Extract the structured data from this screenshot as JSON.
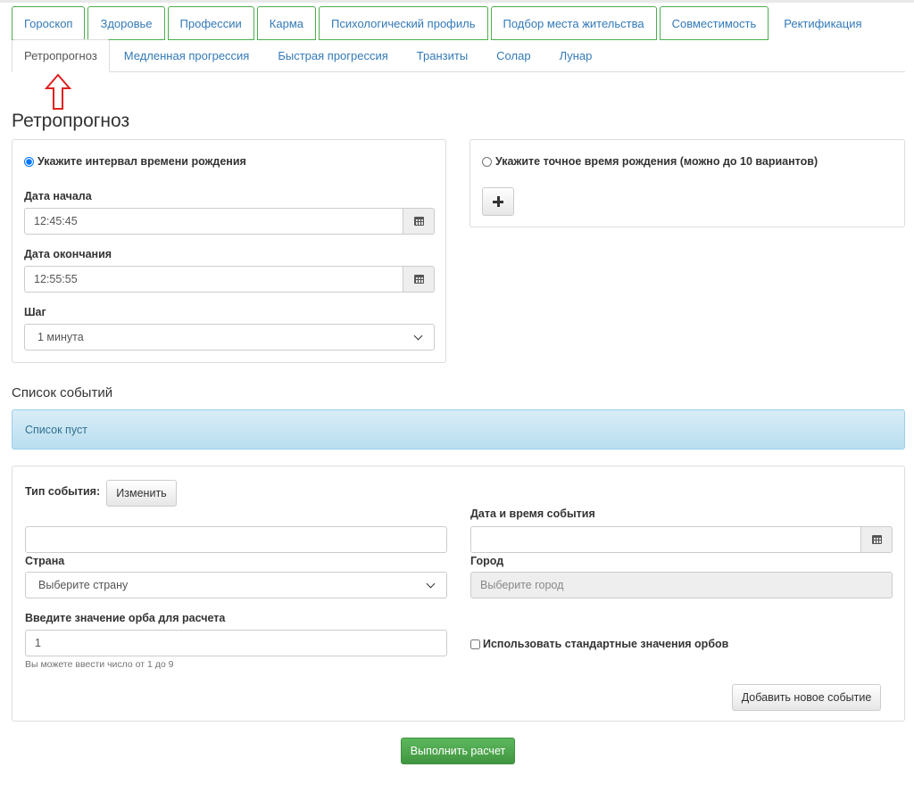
{
  "tabs_main": [
    {
      "label": "Гороскоп"
    },
    {
      "label": "Здоровье"
    },
    {
      "label": "Профессии"
    },
    {
      "label": "Карма"
    },
    {
      "label": "Психологический профиль"
    },
    {
      "label": "Подбор места жительства"
    },
    {
      "label": "Совместимость"
    },
    {
      "label": "Ректификация"
    }
  ],
  "tabs_sub": [
    {
      "label": "Ретропрогноз",
      "active": true
    },
    {
      "label": "Медленная прогрессия"
    },
    {
      "label": "Быстрая прогрессия"
    },
    {
      "label": "Транзиты"
    },
    {
      "label": "Солар"
    },
    {
      "label": "Лунар"
    }
  ],
  "page": {
    "title": "Ретропрогноз"
  },
  "interval_panel": {
    "radio_label": "Укажите интервал времени рождения",
    "start_label": "Дата начала",
    "start_value": "12:45:45",
    "end_label": "Дата окончания",
    "end_value": "12:55:55",
    "step_label": "Шаг",
    "step_value": "1 минута"
  },
  "exact_panel": {
    "radio_label": "Укажите точное время рождения (можно до 10 вариантов)",
    "add_icon": "plus-icon"
  },
  "events": {
    "title": "Список событий",
    "empty_text": "Список пуст"
  },
  "event_form": {
    "type_label": "Тип события:",
    "change_button": "Изменить",
    "type_value": "",
    "datetime_label": "Дата и время события",
    "datetime_value": "",
    "country_label": "Страна",
    "country_value": "Выберите страну",
    "city_label": "Город",
    "city_placeholder": "Выберите город",
    "orb_label": "Введите значение орба для расчета",
    "orb_value": "1",
    "orb_help": "Вы можете ввести число от 1 до 9",
    "standard_orbs_label": "Использовать стандартные значения орбов",
    "add_event_button": "Добавить новое событие"
  },
  "submit": {
    "label": "Выполнить расчет"
  },
  "colors": {
    "accent_green": "#5cb85c",
    "link_blue": "#337ab7",
    "annotation_red": "#e02020",
    "info_blue": "#d9edf7"
  }
}
